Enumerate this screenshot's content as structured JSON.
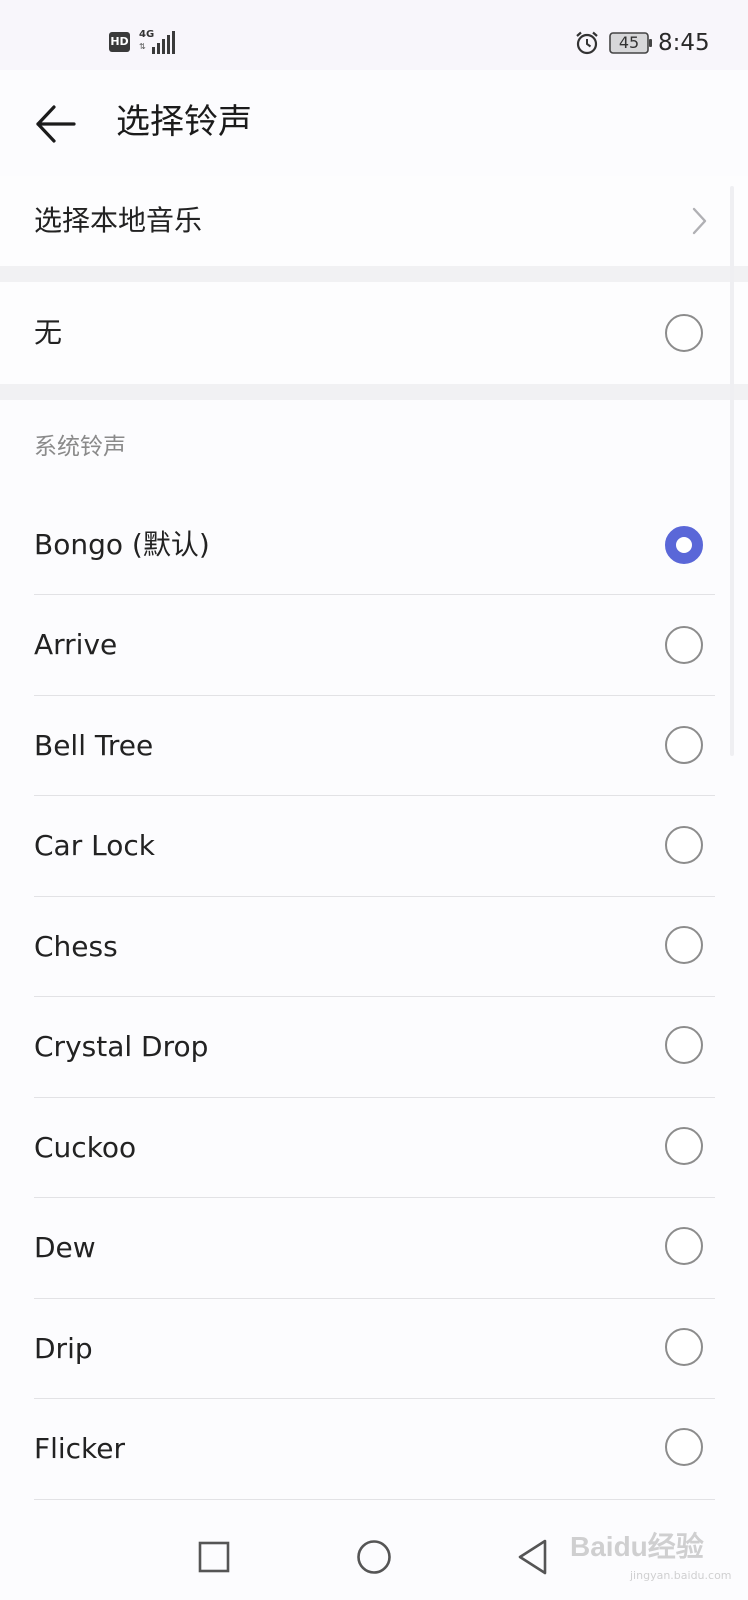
{
  "status_bar": {
    "hd": "HD",
    "network": "4G",
    "battery": "45",
    "time": "8:45",
    "icons": [
      "hd-icon",
      "signal-icon",
      "alarm-icon",
      "battery-icon"
    ]
  },
  "header": {
    "title": "选择铃声",
    "back_icon": "back-arrow-icon"
  },
  "local_music": {
    "label": "选择本地音乐",
    "icon": "chevron-right-icon"
  },
  "none_option": {
    "label": "无",
    "selected": false
  },
  "system_ringtones": {
    "title": "系统铃声",
    "items": [
      {
        "label": "Bongo (默认)",
        "selected": true
      },
      {
        "label": "Arrive",
        "selected": false
      },
      {
        "label": "Bell Tree",
        "selected": false
      },
      {
        "label": "Car Lock",
        "selected": false
      },
      {
        "label": "Chess",
        "selected": false
      },
      {
        "label": "Crystal Drop",
        "selected": false
      },
      {
        "label": "Cuckoo",
        "selected": false
      },
      {
        "label": "Dew",
        "selected": false
      },
      {
        "label": "Drip",
        "selected": false
      },
      {
        "label": "Flicker",
        "selected": false
      }
    ]
  },
  "nav_bar": {
    "icons": [
      "recent-apps-icon",
      "home-icon",
      "back-icon"
    ]
  },
  "watermark": {
    "text": "Baidu经验",
    "url": "jingyan.baidu.com"
  },
  "colors": {
    "accent": "#5a67d8",
    "divider": "#e2e2e5",
    "section_gap": "#f1f1f3"
  }
}
